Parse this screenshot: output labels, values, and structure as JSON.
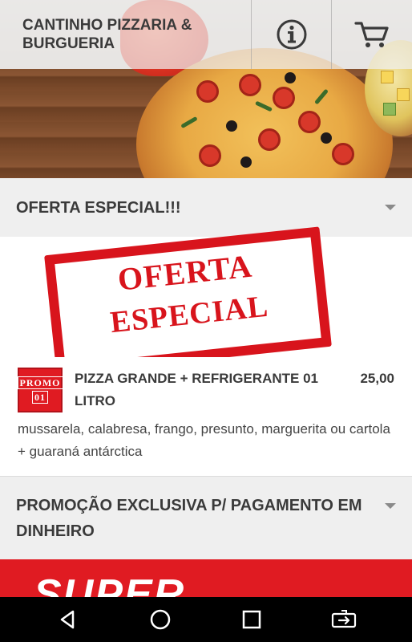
{
  "header": {
    "title": "CANTINHO PIZZARIA & BURGUERIA",
    "info_icon": "info-icon",
    "cart_icon": "cart-icon"
  },
  "sections": [
    {
      "title": "OFERTA ESPECIAL!!!",
      "banner_text_line1": "OFERTA",
      "banner_text_line2": "ESPECIAL",
      "items": [
        {
          "thumb_line1": "PROMO",
          "thumb_line2": "01",
          "name": "PIZZA GRANDE + REFRIGERANTE 01 LITRO",
          "price": "25,00",
          "description": "mussarela, calabresa, frango, presunto, marguerita ou cartola + guaraná antárctica"
        }
      ]
    },
    {
      "title": "PROMOÇÃO EXCLUSIVA P/ PAGAMENTO EM DINHEIRO",
      "banner_text": "SUPER"
    }
  ],
  "navbar": {
    "back_icon": "back-triangle-icon",
    "home_icon": "home-circle-icon",
    "recents_icon": "recents-square-icon",
    "rotate_icon": "rotate-screen-icon"
  },
  "colors": {
    "accent_red": "#e01b22",
    "header_bg": "#efefef",
    "text_dark": "#3a3a3a"
  }
}
